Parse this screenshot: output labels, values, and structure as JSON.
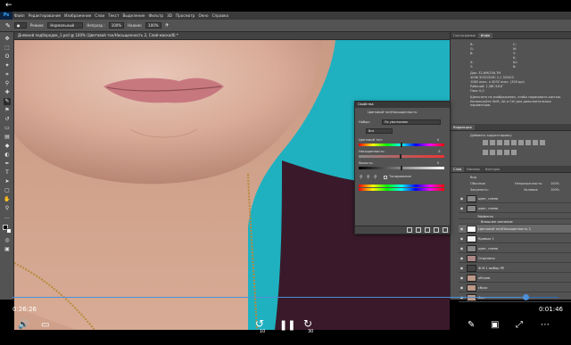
{
  "player": {
    "back_glyph": "←",
    "time_elapsed": "0:26:26",
    "time_remaining": "0:01:46",
    "progress": 0.94,
    "skip_back_label": "10",
    "skip_forward_label": "30",
    "icons": {
      "volume": "volume-icon",
      "captions": "captions-icon",
      "skip_back": "skip-back-10-icon",
      "pause": "pause-icon",
      "skip_forward": "skip-forward-30-icon",
      "edit": "pen-icon",
      "cast": "cast-icon",
      "fullscreen": "fullscreen-icon",
      "more": "more-icon"
    }
  },
  "photoshop": {
    "logo": "Ps",
    "menu": [
      "Файл",
      "Редактирование",
      "Изображение",
      "Слои",
      "Текст",
      "Выделение",
      "Фильтр",
      "3D",
      "Просмотр",
      "Окно",
      "Справка"
    ],
    "options": {
      "mode_label": "Режим:",
      "mode_value": "Нормальный",
      "opacity_label": "Непрозр.:",
      "opacity_value": "100%",
      "pressure_label": "Нажим:",
      "pressure_value": "100%"
    },
    "document_tab": "Дневной подбородок_1.psd @ 100% (Цветовой тон/Насыщенность 2, Слой-маска/8) *",
    "panels": {
      "info": {
        "tabs": [
          "Гистограмма",
          "Инфо"
        ],
        "rgb": [
          "R:",
          "G:",
          "B:"
        ],
        "hsb": [
          "C:",
          "M:",
          "Y:",
          "K:"
        ],
        "xy": [
          "X:",
          "Y:"
        ],
        "wh": [
          "Ш:",
          "В:"
        ],
        "doc_lines": [
          "Док: 32,6М/256,7М",
          "4096 ЗО5ОЗ2М: 2,1 ЗО5ОЗ",
          "1080 пикс. х 4032 пикс. (300 ppi)",
          "Рабочий: 1,38Г/161Г",
          "Пикс 0,0"
        ],
        "hint": "Щелкните на изображении, чтобы нарисовать кистью. Используйте Shift, Alt и Ctrl для дополнительных параметров."
      },
      "adjustments": {
        "tabs": [
          "Коррекция"
        ],
        "title": "Добавить корректировку"
      },
      "layers": {
        "tabs": [
          "Слои",
          "Каналы",
          "Контуры"
        ],
        "kind_label": "Вид",
        "blend": "Обычные",
        "opacity_label": "Непрозрачность:",
        "opacity_value": "100%",
        "fill_label": "Заливка:",
        "fill_value": "100%",
        "lock_label": "Закрепить:",
        "items": [
          {
            "name": "цвет, слева"
          },
          {
            "name": "цвет, слева"
          },
          {
            "name": "Эффекты"
          },
          {
            "name": "Внешнее свечение"
          },
          {
            "name": "Цветовой тон/Насыщенность 2"
          },
          {
            "name": "Кривые 1"
          },
          {
            "name": "цвет, слева"
          },
          {
            "name": "Отделено"
          },
          {
            "name": "Ф.М.1 выбор РЕ"
          },
          {
            "name": "обтрав"
          },
          {
            "name": "сброс"
          },
          {
            "name": "Фон"
          }
        ]
      },
      "properties": {
        "title": "Свойства",
        "subtitle": "Цветовой тон/Насыщенность",
        "preset_label": "Набор:",
        "preset_value": "По умолчанию",
        "channel_value": "Все",
        "hue_label": "Цветовой тон:",
        "hue_value": "0",
        "sat_label": "Насыщенность:",
        "sat_value": "-3",
        "light_label": "Яркость:",
        "light_value": "0",
        "colorize_label": "Тонирование"
      }
    }
  }
}
